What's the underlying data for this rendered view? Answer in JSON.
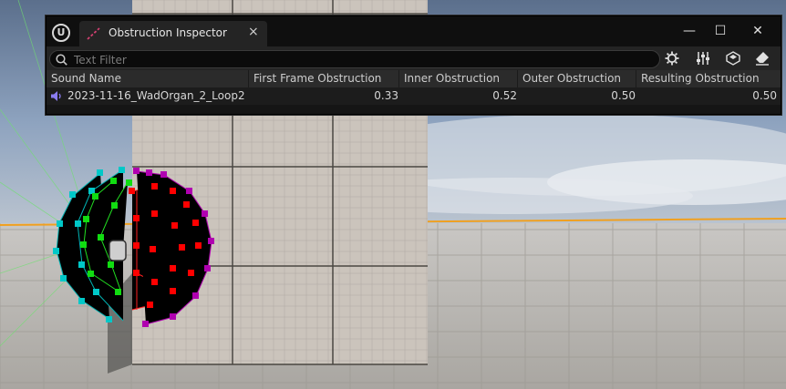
{
  "window": {
    "tab_title": "Obstruction Inspector",
    "close_tab": "×",
    "minimize": "—",
    "maximize": "☐",
    "close": "✕"
  },
  "search": {
    "placeholder": "Text Filter",
    "value": ""
  },
  "toolbar_icons": [
    "settings-icon",
    "sliders-icon",
    "plugin-icon",
    "eraser-icon"
  ],
  "columns": [
    "Sound Name",
    "First Frame Obstruction",
    "Inner Obstruction",
    "Outer Obstruction",
    "Resulting Obstruction"
  ],
  "rows": [
    {
      "name": "2023-11-16_WadOrgan_2_Loop2",
      "first_frame": "0.33",
      "inner": "0.52",
      "outer": "0.50",
      "resulting": "0.50"
    }
  ],
  "colors": {
    "sky": "#6b86a8",
    "floor": "#b8b5b0",
    "pillar": "#c9c2ba",
    "horizon_line": "#f0a020",
    "sphere_cyan": "#00c8c8",
    "sphere_green": "#00e000",
    "sphere_red": "#ff0000",
    "sphere_purple": "#b000b0"
  }
}
